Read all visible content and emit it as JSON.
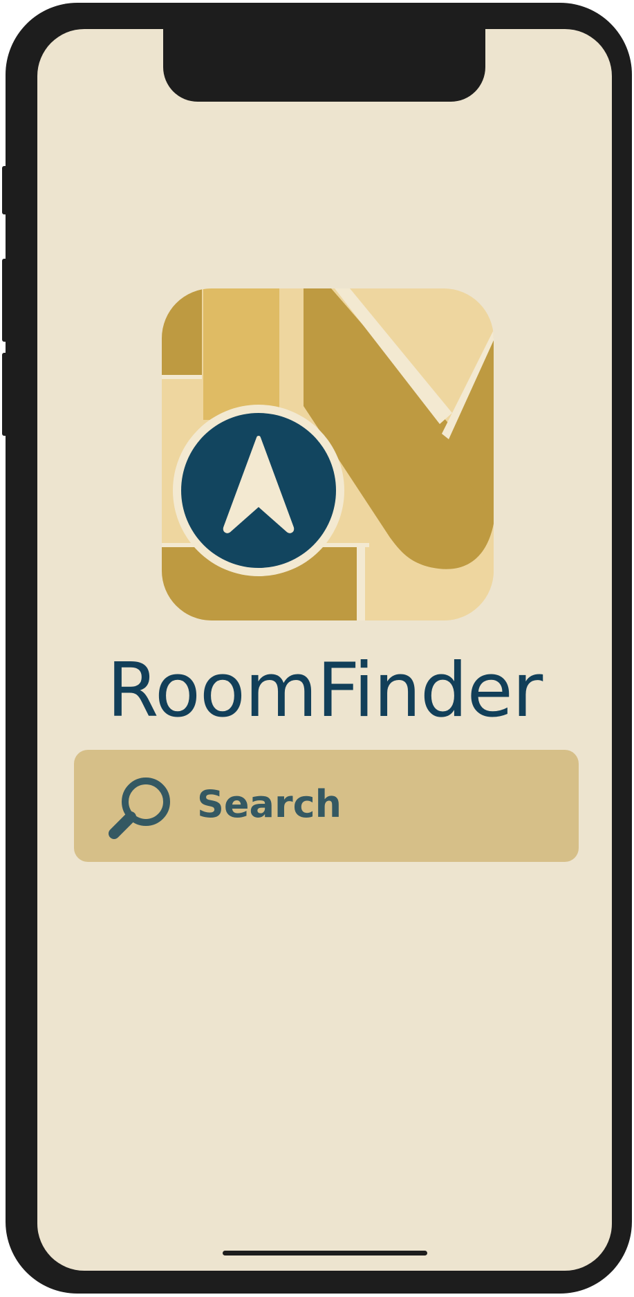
{
  "app": {
    "title": "RoomFinder"
  },
  "logo": {
    "icon": "map-navigation-arrow-icon",
    "colors": {
      "gold_dark": "#be9a41",
      "gold_mid": "#dfbb64",
      "gold_light": "#eed69f",
      "navy": "#12455f",
      "cream": "#f3e9d1"
    }
  },
  "search": {
    "placeholder": "Search",
    "icon": "search-icon"
  },
  "theme": {
    "screen_background": "#ede4cf",
    "search_background": "#d6bf88",
    "title_color": "#123f59",
    "device_frame": "#1d1d1d"
  }
}
